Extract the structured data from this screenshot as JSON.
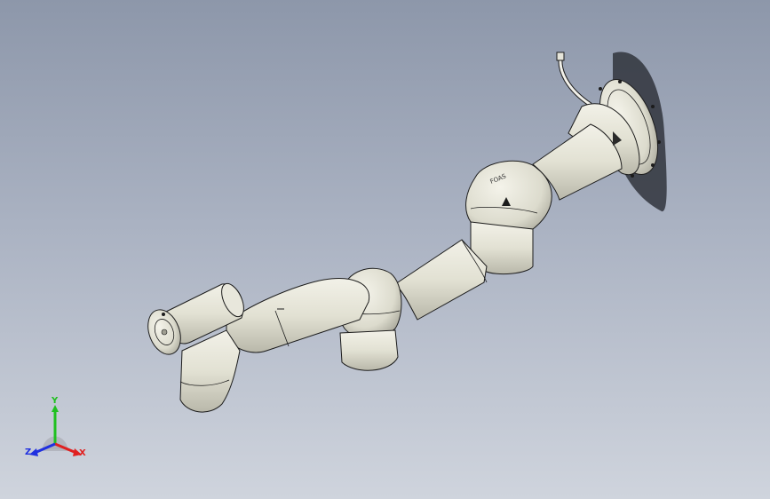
{
  "viewport": {
    "background_top": "#8d97aa",
    "background_bottom": "#cfd4dd",
    "model_fill": "#e3e2d5",
    "model_edge": "#1c1c1c"
  },
  "model": {
    "housing_marking": "FOAS"
  },
  "triad": {
    "x_label": "X",
    "y_label": "Y",
    "z_label": "Z",
    "x_color": "#e02020",
    "y_color": "#20c020",
    "z_color": "#2030e0"
  }
}
